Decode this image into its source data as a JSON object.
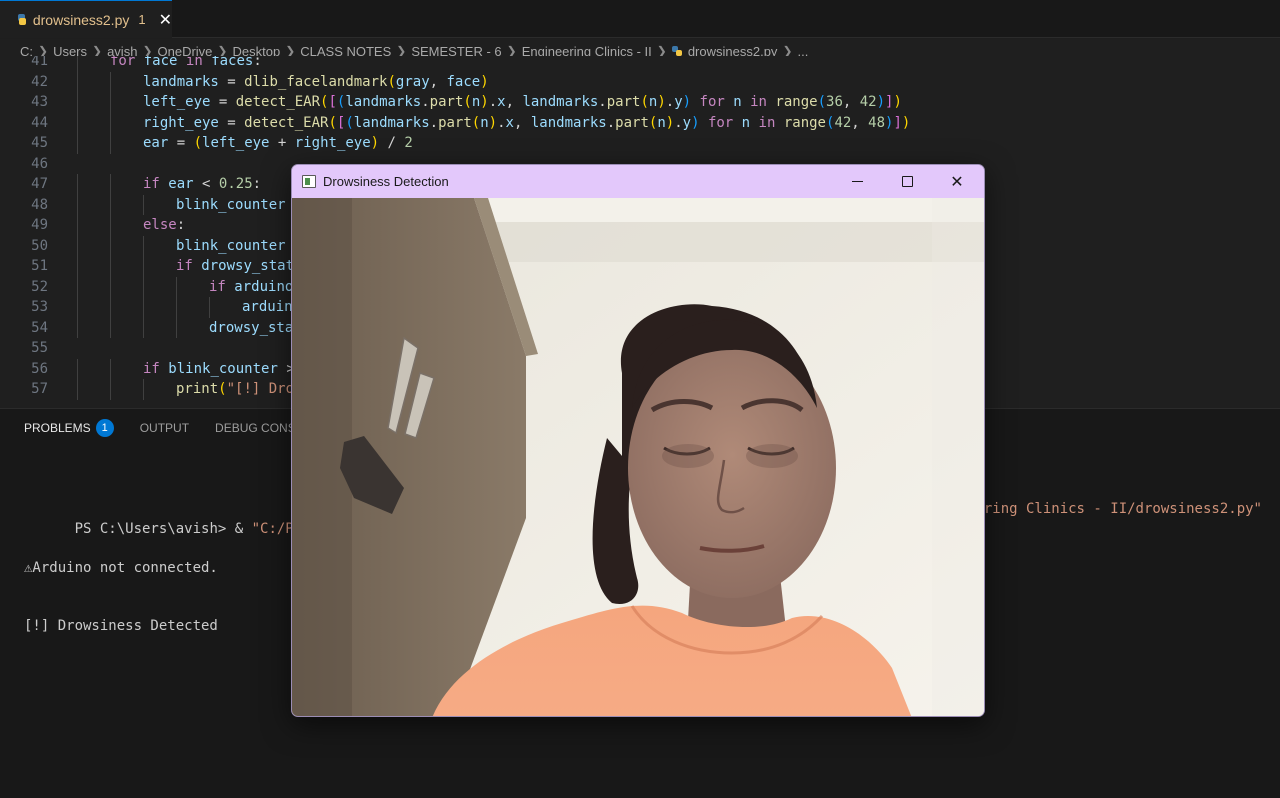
{
  "editor_tab": {
    "filename": "drowsiness2.py",
    "badge": "1",
    "close_glyph": "✕"
  },
  "breadcrumbs": [
    "C:",
    "Users",
    "avish",
    "OneDrive",
    "Desktop",
    "CLASS NOTES",
    "SEMESTER - 6",
    "Engineering Clinics - II",
    "drowsiness2.py",
    "..."
  ],
  "code_lines": [
    {
      "n": "41",
      "text": "for face in faces:"
    },
    {
      "n": "42",
      "text": "landmarks = dlib_facelandmark(gray, face)"
    },
    {
      "n": "43",
      "text": "left_eye = detect_EAR([(landmarks.part(n).x, landmarks.part(n).y) for n in range(36, 42)])"
    },
    {
      "n": "44",
      "text": "right_eye = detect_EAR([(landmarks.part(n).x, landmarks.part(n).y) for n in range(42, 48)])"
    },
    {
      "n": "45",
      "text": "ear = (left_eye + right_eye) / 2"
    },
    {
      "n": "46",
      "text": ""
    },
    {
      "n": "47",
      "text": "if ear < 0.25:"
    },
    {
      "n": "48",
      "text": "blink_counter"
    },
    {
      "n": "49",
      "text": "else:"
    },
    {
      "n": "50",
      "text": "blink_counter"
    },
    {
      "n": "51",
      "text": "if drowsy_stat"
    },
    {
      "n": "52",
      "text": "if arduino"
    },
    {
      "n": "53",
      "text": "arduin"
    },
    {
      "n": "54",
      "text": "drowsy_sta"
    },
    {
      "n": "55",
      "text": ""
    },
    {
      "n": "56",
      "text": "if blink_counter >"
    },
    {
      "n": "57",
      "text": "print(\"[!] Dro"
    }
  ],
  "panel": {
    "tabs": [
      {
        "label": "PROBLEMS",
        "badge": "1"
      },
      {
        "label": "OUTPUT"
      },
      {
        "label": "DEBUG CONSOLE"
      }
    ],
    "terminal": {
      "prompt": "PS C:\\Users\\avish> & ",
      "command_start": "\"C:/Program F",
      "command_end": "eering Clinics - II/drowsiness2.py\"",
      "line2": "⚠Arduino not connected.",
      "line3": "[!] Drowsiness Detected"
    }
  },
  "cv_window": {
    "title": "Drowsiness Detection",
    "close_glyph": "✕"
  },
  "colors": {
    "accent": "#0078d4",
    "titlebar": "#e3c8fb",
    "modified_file": "#e2c08d"
  }
}
